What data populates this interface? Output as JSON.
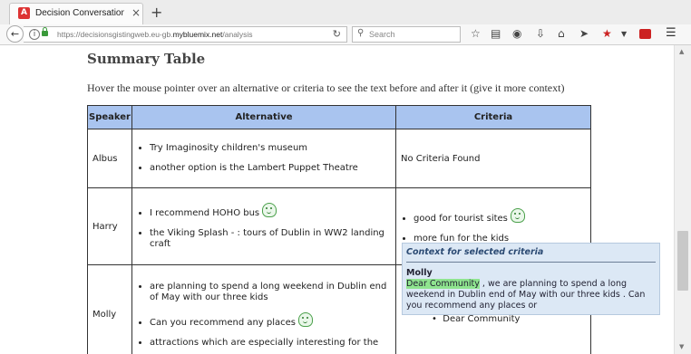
{
  "browser": {
    "tab_title": "Decision Conversations De...",
    "tab_close": "×",
    "new_tab": "+",
    "url_prefix": "https://decisionsgistingweb.eu-gb.",
    "url_domain": "mybluemix.net",
    "url_path": "/analysis",
    "search_placeholder": "Search"
  },
  "page": {
    "title": "Summary Table",
    "hint": "Hover the mouse pointer over an alternative or criteria to see the text before and after it (give it more context)"
  },
  "table": {
    "headers": [
      "Speaker",
      "Alternative",
      "Criteria"
    ],
    "rows": [
      {
        "speaker": "Albus",
        "alternatives": [
          "Try Imaginosity children's museum",
          "another option is the Lambert Puppet Theatre"
        ],
        "criteria_text": "No Criteria Found"
      },
      {
        "speaker": "Harry",
        "alternatives": [
          "I recommend HOHO bus",
          "the Viking Splash - : tours of Dublin in WW2 landing craft"
        ],
        "criteria": [
          "good for tourist sites",
          "more fun for the kids"
        ]
      },
      {
        "speaker": "Molly",
        "alternatives": [
          "are planning to spend a long weekend in Dublin end of May with our three kids",
          "Can you recommend any places",
          "attractions which are especially interesting for the"
        ],
        "criteria": [
          "Dear Community"
        ]
      }
    ]
  },
  "tooltip": {
    "heading": "Context for selected criteria",
    "speaker": "Molly",
    "highlight": "Dear Community",
    "rest": " , we are planning to spend a long weekend in Dublin end of May with our three kids . Can you recommend any places or"
  },
  "icons": {
    "smiley": "smiley-face-icon",
    "accent_color": "#a9c4ef",
    "highlight_color": "#8fe48f"
  }
}
